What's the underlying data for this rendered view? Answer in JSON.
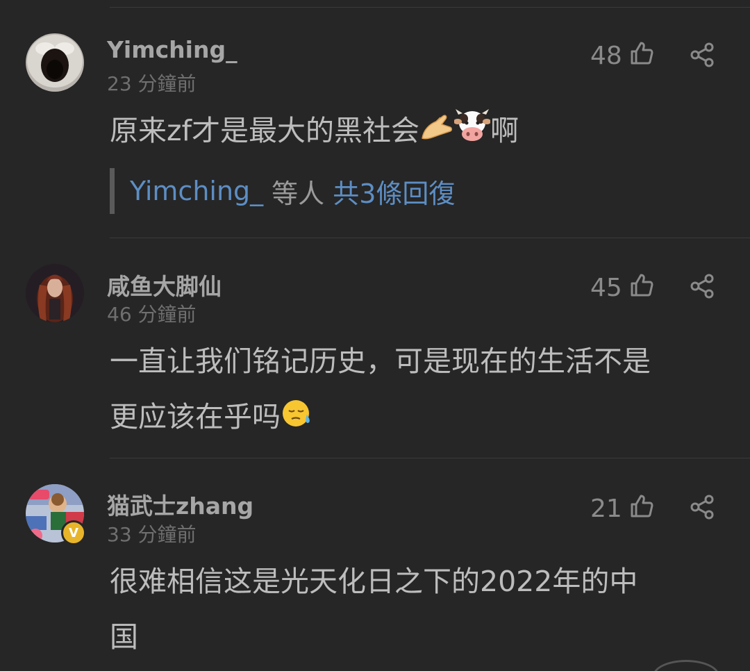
{
  "comments": [
    {
      "username": "Yimching_",
      "time": "23 分鐘前",
      "likes": "48",
      "text": "原来zf才是最大的黑社会",
      "text_after": "啊",
      "emojis": [
        "pinching-hand-emoji",
        "cow-face-emoji"
      ],
      "replies": {
        "name": "Yimching_",
        "others": "等人",
        "count": "共3條回復"
      }
    },
    {
      "username": "咸鱼大脚仙",
      "time": "46 分鐘前",
      "likes": "45",
      "text_line1": "一直让我们铭记历史，可是现在的生活不是",
      "text_line2": "更应该在乎吗",
      "emojis": [
        "downcast-sweat-emoji"
      ]
    },
    {
      "username": "猫武士zhang",
      "time": "33 分鐘前",
      "likes": "21",
      "badge": "V",
      "text_line1": "很难相信这是光天化日之下的2022年的中",
      "text_line2": "国"
    }
  ],
  "colors": {
    "background": "#262626",
    "link": "#5d8ec4",
    "username": "#a6a6a6",
    "time": "#6f6f6f",
    "body": "#bdbdbd"
  }
}
